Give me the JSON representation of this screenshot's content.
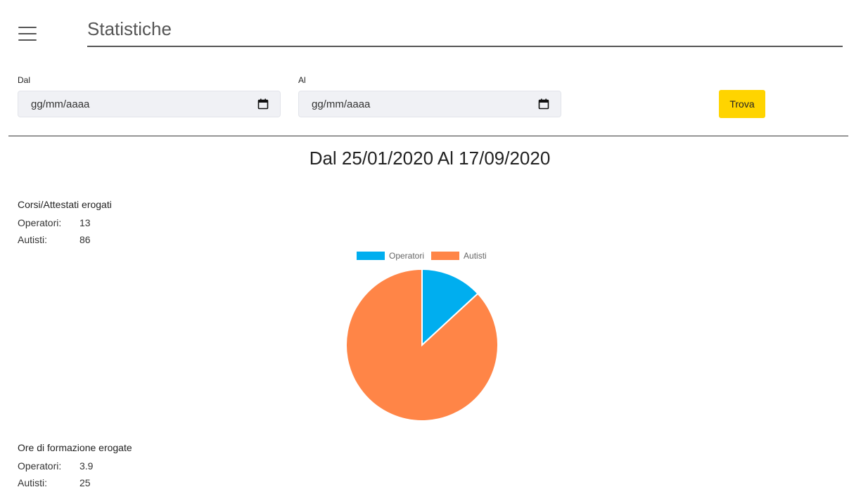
{
  "header": {
    "title": "Statistiche"
  },
  "filters": {
    "from_label": "Dal",
    "from_placeholder": "gg/mm/aaaa",
    "to_label": "Al",
    "to_placeholder": "gg/mm/aaaa",
    "search_button": "Trova"
  },
  "range_heading": "Dal 25/01/2020 Al 17/09/2020",
  "courses": {
    "heading": "Corsi/Attestati erogati",
    "rows": [
      {
        "label": "Operatori:",
        "value": "13"
      },
      {
        "label": "Autisti:",
        "value": "86"
      }
    ]
  },
  "hours": {
    "heading": "Ore di formazione erogate",
    "rows": [
      {
        "label": "Operatori:",
        "value": "3.9"
      },
      {
        "label": "Autisti:",
        "value": "25"
      }
    ]
  },
  "chart_data": {
    "type": "pie",
    "categories": [
      "Operatori",
      "Autisti"
    ],
    "values": [
      13,
      86
    ],
    "colors": [
      "#00aeef",
      "#ff8547"
    ],
    "legend": "top"
  },
  "colors": {
    "accent_button": "#ffd400",
    "input_background": "#f0f1f5"
  },
  "icons": {
    "menu": "menu-icon",
    "calendar": "calendar-icon"
  }
}
